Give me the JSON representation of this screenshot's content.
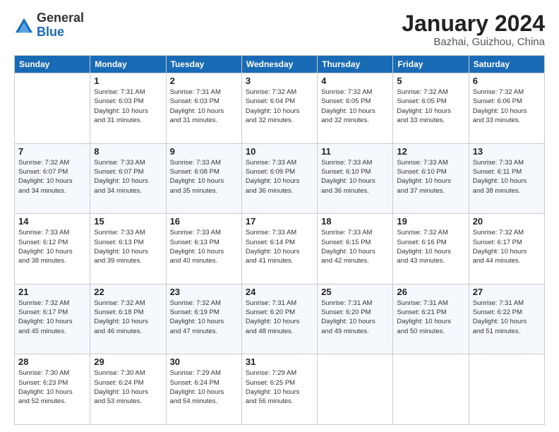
{
  "logo": {
    "general": "General",
    "blue": "Blue"
  },
  "header": {
    "month": "January 2024",
    "location": "Bazhai, Guizhou, China"
  },
  "weekdays": [
    "Sunday",
    "Monday",
    "Tuesday",
    "Wednesday",
    "Thursday",
    "Friday",
    "Saturday"
  ],
  "weeks": [
    [
      {
        "day": "",
        "info": ""
      },
      {
        "day": "1",
        "info": "Sunrise: 7:31 AM\nSunset: 6:03 PM\nDaylight: 10 hours\nand 31 minutes."
      },
      {
        "day": "2",
        "info": "Sunrise: 7:31 AM\nSunset: 6:03 PM\nDaylight: 10 hours\nand 31 minutes."
      },
      {
        "day": "3",
        "info": "Sunrise: 7:32 AM\nSunset: 6:04 PM\nDaylight: 10 hours\nand 32 minutes."
      },
      {
        "day": "4",
        "info": "Sunrise: 7:32 AM\nSunset: 6:05 PM\nDaylight: 10 hours\nand 32 minutes."
      },
      {
        "day": "5",
        "info": "Sunrise: 7:32 AM\nSunset: 6:05 PM\nDaylight: 10 hours\nand 33 minutes."
      },
      {
        "day": "6",
        "info": "Sunrise: 7:32 AM\nSunset: 6:06 PM\nDaylight: 10 hours\nand 33 minutes."
      }
    ],
    [
      {
        "day": "7",
        "info": "Sunrise: 7:32 AM\nSunset: 6:07 PM\nDaylight: 10 hours\nand 34 minutes."
      },
      {
        "day": "8",
        "info": "Sunrise: 7:33 AM\nSunset: 6:07 PM\nDaylight: 10 hours\nand 34 minutes."
      },
      {
        "day": "9",
        "info": "Sunrise: 7:33 AM\nSunset: 6:08 PM\nDaylight: 10 hours\nand 35 minutes."
      },
      {
        "day": "10",
        "info": "Sunrise: 7:33 AM\nSunset: 6:09 PM\nDaylight: 10 hours\nand 36 minutes."
      },
      {
        "day": "11",
        "info": "Sunrise: 7:33 AM\nSunset: 6:10 PM\nDaylight: 10 hours\nand 36 minutes."
      },
      {
        "day": "12",
        "info": "Sunrise: 7:33 AM\nSunset: 6:10 PM\nDaylight: 10 hours\nand 37 minutes."
      },
      {
        "day": "13",
        "info": "Sunrise: 7:33 AM\nSunset: 6:11 PM\nDaylight: 10 hours\nand 38 minutes."
      }
    ],
    [
      {
        "day": "14",
        "info": "Sunrise: 7:33 AM\nSunset: 6:12 PM\nDaylight: 10 hours\nand 38 minutes."
      },
      {
        "day": "15",
        "info": "Sunrise: 7:33 AM\nSunset: 6:13 PM\nDaylight: 10 hours\nand 39 minutes."
      },
      {
        "day": "16",
        "info": "Sunrise: 7:33 AM\nSunset: 6:13 PM\nDaylight: 10 hours\nand 40 minutes."
      },
      {
        "day": "17",
        "info": "Sunrise: 7:33 AM\nSunset: 6:14 PM\nDaylight: 10 hours\nand 41 minutes."
      },
      {
        "day": "18",
        "info": "Sunrise: 7:33 AM\nSunset: 6:15 PM\nDaylight: 10 hours\nand 42 minutes."
      },
      {
        "day": "19",
        "info": "Sunrise: 7:32 AM\nSunset: 6:16 PM\nDaylight: 10 hours\nand 43 minutes."
      },
      {
        "day": "20",
        "info": "Sunrise: 7:32 AM\nSunset: 6:17 PM\nDaylight: 10 hours\nand 44 minutes."
      }
    ],
    [
      {
        "day": "21",
        "info": "Sunrise: 7:32 AM\nSunset: 6:17 PM\nDaylight: 10 hours\nand 45 minutes."
      },
      {
        "day": "22",
        "info": "Sunrise: 7:32 AM\nSunset: 6:18 PM\nDaylight: 10 hours\nand 46 minutes."
      },
      {
        "day": "23",
        "info": "Sunrise: 7:32 AM\nSunset: 6:19 PM\nDaylight: 10 hours\nand 47 minutes."
      },
      {
        "day": "24",
        "info": "Sunrise: 7:31 AM\nSunset: 6:20 PM\nDaylight: 10 hours\nand 48 minutes."
      },
      {
        "day": "25",
        "info": "Sunrise: 7:31 AM\nSunset: 6:20 PM\nDaylight: 10 hours\nand 49 minutes."
      },
      {
        "day": "26",
        "info": "Sunrise: 7:31 AM\nSunset: 6:21 PM\nDaylight: 10 hours\nand 50 minutes."
      },
      {
        "day": "27",
        "info": "Sunrise: 7:31 AM\nSunset: 6:22 PM\nDaylight: 10 hours\nand 51 minutes."
      }
    ],
    [
      {
        "day": "28",
        "info": "Sunrise: 7:30 AM\nSunset: 6:23 PM\nDaylight: 10 hours\nand 52 minutes."
      },
      {
        "day": "29",
        "info": "Sunrise: 7:30 AM\nSunset: 6:24 PM\nDaylight: 10 hours\nand 53 minutes."
      },
      {
        "day": "30",
        "info": "Sunrise: 7:29 AM\nSunset: 6:24 PM\nDaylight: 10 hours\nand 54 minutes."
      },
      {
        "day": "31",
        "info": "Sunrise: 7:29 AM\nSunset: 6:25 PM\nDaylight: 10 hours\nand 56 minutes."
      },
      {
        "day": "",
        "info": ""
      },
      {
        "day": "",
        "info": ""
      },
      {
        "day": "",
        "info": ""
      }
    ]
  ]
}
